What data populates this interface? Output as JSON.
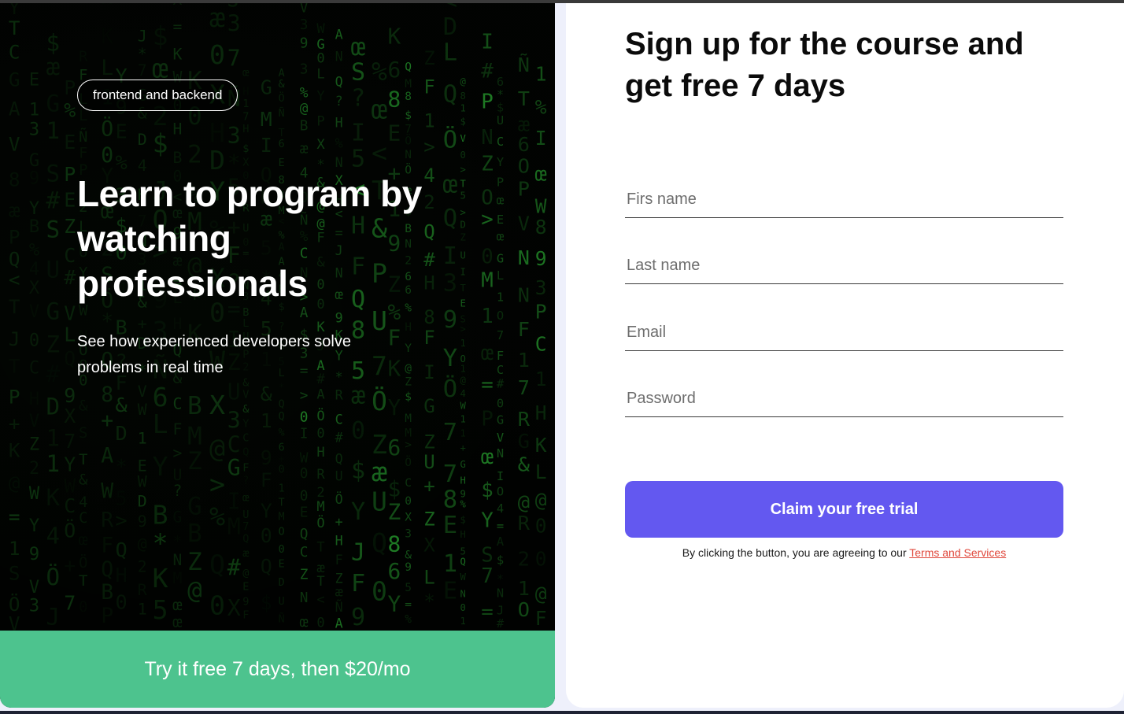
{
  "hero": {
    "tag": "frontend and backend",
    "title": "Learn to program by watching professionals",
    "subtitle": "See how experienced developers solve problems in real time",
    "trial_banner": "Try it free 7 days, then $20/mo"
  },
  "form": {
    "title": "Sign up for the course and get free 7 days",
    "fields": [
      {
        "placeholder": "Firs name",
        "value": ""
      },
      {
        "placeholder": "Last name",
        "value": ""
      },
      {
        "placeholder": "Email",
        "value": ""
      },
      {
        "placeholder": "Password",
        "value": ""
      }
    ],
    "submit_label": "Claim your free trial",
    "agreement_text": "By clicking the button, you are agreeing to our ",
    "terms_link": "Terms and Services"
  },
  "colors": {
    "accent": "#6358f0",
    "trial_green": "#4dc38e",
    "terms_link": "#e0483c",
    "hero_bg": "#020502"
  }
}
